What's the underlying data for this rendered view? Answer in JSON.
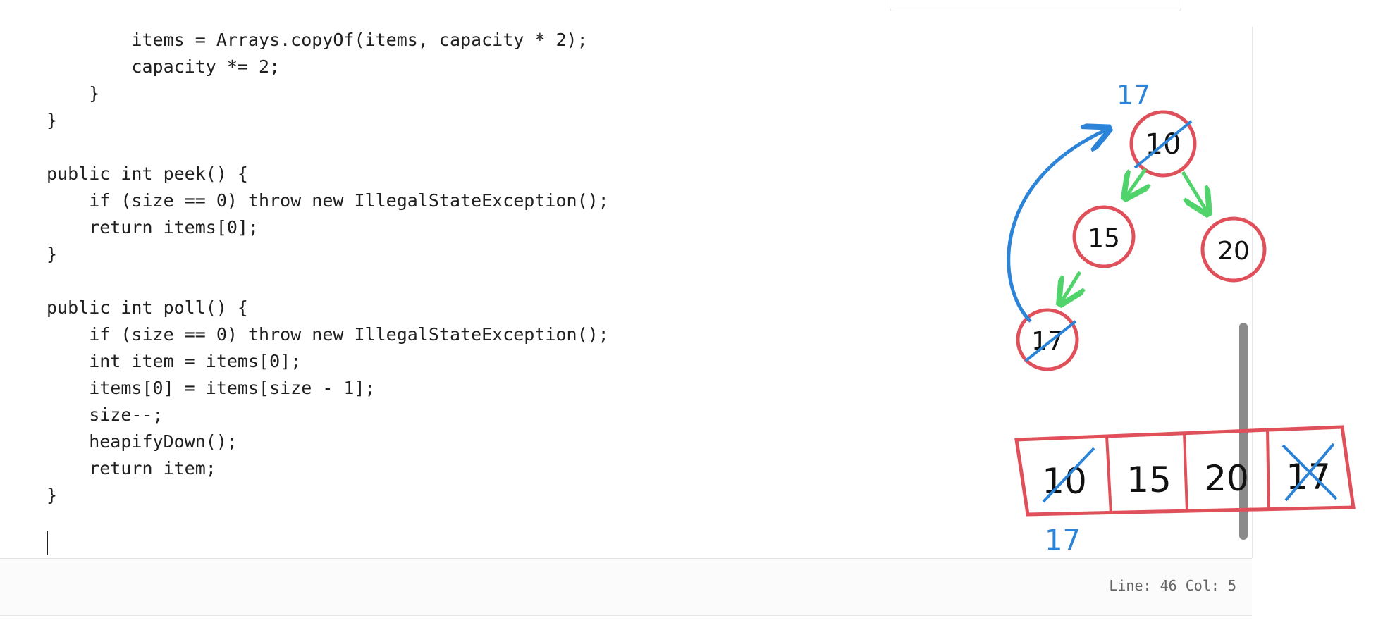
{
  "code": {
    "lines": [
      "        items = Arrays.copyOf(items, capacity * 2);",
      "        capacity *= 2;",
      "    }",
      "}",
      "",
      "public int peek() {",
      "    if (size == 0) throw new IllegalStateException();",
      "    return items[0];",
      "}",
      "",
      "public int poll() {",
      "    if (size == 0) throw new IllegalStateException();",
      "    int item = items[0];",
      "    items[0] = items[size - 1];",
      "    size--;",
      "    heapifyDown();",
      "    return item;",
      "}",
      ""
    ]
  },
  "status": {
    "line_label": "Line:",
    "line_value": "46",
    "col_label": "Col:",
    "col_value": "5"
  },
  "drawing": {
    "tree_nodes": [
      "10",
      "15",
      "20",
      "17"
    ],
    "array_cells": [
      "10",
      "15",
      "20",
      "17"
    ],
    "annotations": {
      "top_label": "17",
      "bottom_label": "17"
    },
    "colors": {
      "node": "#e0505a",
      "annotation": "#2b84d8",
      "arrow": "#4fd36a"
    }
  }
}
